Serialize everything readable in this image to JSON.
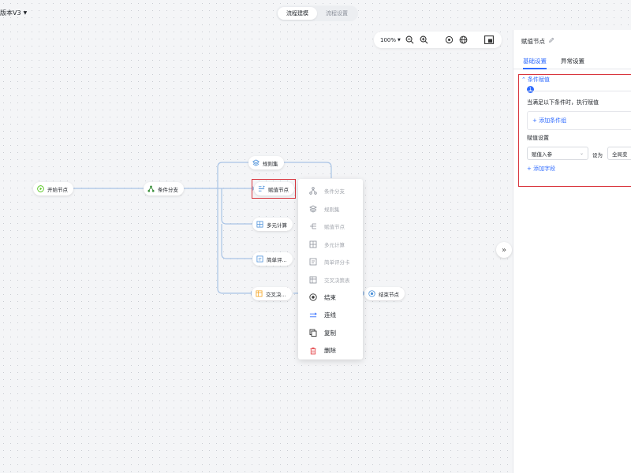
{
  "header": {
    "version_label": "版本V3",
    "tabs": [
      {
        "label": "流程建模",
        "active": true
      },
      {
        "label": "流程设置",
        "active": false
      }
    ]
  },
  "toolbar": {
    "zoom": "100%",
    "icons": [
      "zoom-out-icon",
      "zoom-in-icon",
      "locate-icon",
      "globe-icon",
      "minimap-icon"
    ]
  },
  "canvas": {
    "nodes": {
      "start": "开始节点",
      "branch": "条件分支",
      "ruleset": "规则集",
      "assign": "赋值节点",
      "multi_calc": "多元计算",
      "scorecard": "简单评...",
      "cross": "交叉决...",
      "end": "结束节点"
    },
    "context_menu": [
      {
        "label": "条件分支",
        "icon": "branch-icon",
        "enabled": false
      },
      {
        "label": "规则集",
        "icon": "layers-icon",
        "enabled": false
      },
      {
        "label": "赋值节点",
        "icon": "assign-icon",
        "enabled": false
      },
      {
        "label": "多元计算",
        "icon": "calculator-icon",
        "enabled": false
      },
      {
        "label": "简单评分卡",
        "icon": "scorecard-icon",
        "enabled": false
      },
      {
        "label": "交叉决策表",
        "icon": "cross-table-icon",
        "enabled": false
      },
      {
        "label": "结束",
        "icon": "end-icon",
        "enabled": true
      },
      {
        "label": "连线",
        "icon": "connect-icon",
        "enabled": true
      },
      {
        "label": "复制",
        "icon": "copy-icon",
        "enabled": true
      },
      {
        "label": "删除",
        "icon": "delete-icon",
        "enabled": true
      }
    ]
  },
  "panel": {
    "title": "赋值节点",
    "tabs": [
      {
        "label": "基础设置",
        "active": true
      },
      {
        "label": "异常设置",
        "active": false
      }
    ],
    "condition_title": "条件赋值",
    "condition_index": "1",
    "condition_text": "当满足以下条件时，执行赋值",
    "add_group": "+ 添加条件组",
    "assign_label": "赋值设置",
    "select_value": "赋值入参",
    "set_as": "设为",
    "target_value": "全局变",
    "add_field": "+ 添加字段"
  },
  "colors": {
    "accent": "#2f6bff",
    "highlight": "#d9363e",
    "start_green": "#52c41a",
    "node_blue": "#4a90d9",
    "node_orange": "#f5a623",
    "edge": "#a9c4e6"
  }
}
